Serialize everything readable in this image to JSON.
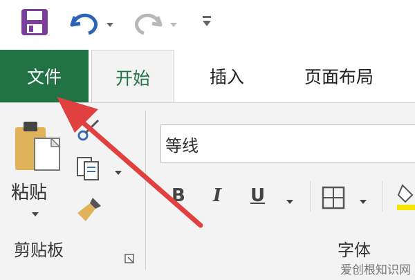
{
  "tabs": {
    "file": "文件",
    "home": "开始",
    "insert": "插入",
    "page_layout": "页面布局"
  },
  "ribbon": {
    "paste_label": "粘贴",
    "clipboard_group": "剪贴板",
    "font_name": "等线",
    "font_group": "字体",
    "bold": "B",
    "italic": "I",
    "underline": "U"
  },
  "watermark": "爱创根知识网",
  "colors": {
    "file_tab": "#217346",
    "arrow": "#e04040"
  }
}
